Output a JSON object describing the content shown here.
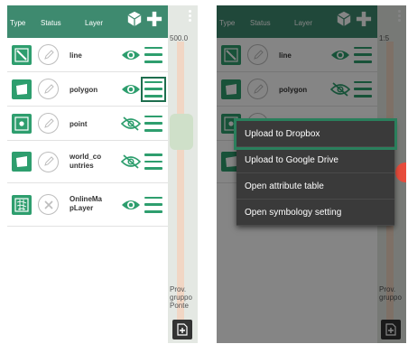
{
  "header": {
    "col_type": "Type",
    "col_status": "Status",
    "col_layer": "Layer",
    "scale_text_left": "500.0",
    "scale_text_right": "1:5"
  },
  "layers": [
    {
      "name": "line",
      "thumb": "line-thumb-icon",
      "visible": true
    },
    {
      "name": "polygon",
      "thumb": "polygon-thumb-icon",
      "visible": true
    },
    {
      "name": "point",
      "thumb": "point-thumb-icon",
      "visible": false
    },
    {
      "name": "world_co untries",
      "thumb": "polygon-thumb-icon",
      "visible": false
    },
    {
      "name": "OnlineMa pLayer",
      "thumb": "tile-thumb-icon",
      "visible": true
    }
  ],
  "context_menu": {
    "items": [
      "Upload to Dropbox",
      "Upload to Google Drive",
      "Open attribute table",
      "Open symbology setting"
    ]
  },
  "map_labels": {
    "left_bottom": "Prov.\ngruppo\nPonte",
    "right_bottom": "Prov.\ngruppo"
  },
  "colors": {
    "accent": "#3e8a6f",
    "icon_green": "#2e9e6e",
    "highlight": "#1e6e4e"
  }
}
